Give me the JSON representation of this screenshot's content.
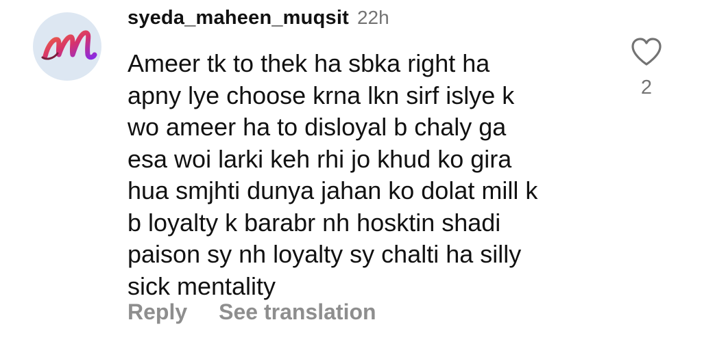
{
  "comment": {
    "username": "syeda_maheen_muqsit",
    "time": "22h",
    "text": "Ameer tk to thek ha sbka right ha\napny lye choose krna lkn sirf islye k\nwo ameer ha to disloyal b chaly ga\nesa woi larki keh rhi jo khud ko gira\nhua smjhti dunya jahan ko dolat mill k\nb loyalty k barabr nh hosktin shadi\npaison sy nh loyalty sy chalti ha silly\nsick mentality",
    "avatar_letter": "M",
    "avatar_colors": [
      "#f26b3a",
      "#d6336c",
      "#8a2be2"
    ],
    "like_count": "2",
    "reply_label": "Reply",
    "translate_label": "See translation"
  },
  "icons": {
    "like": "heart-outline-icon",
    "avatar": "avatar-monogram-icon"
  },
  "colors": {
    "text": "#111111",
    "secondary": "#737373",
    "action": "#8e8e8e",
    "avatar_bg": "#dde7f2"
  }
}
